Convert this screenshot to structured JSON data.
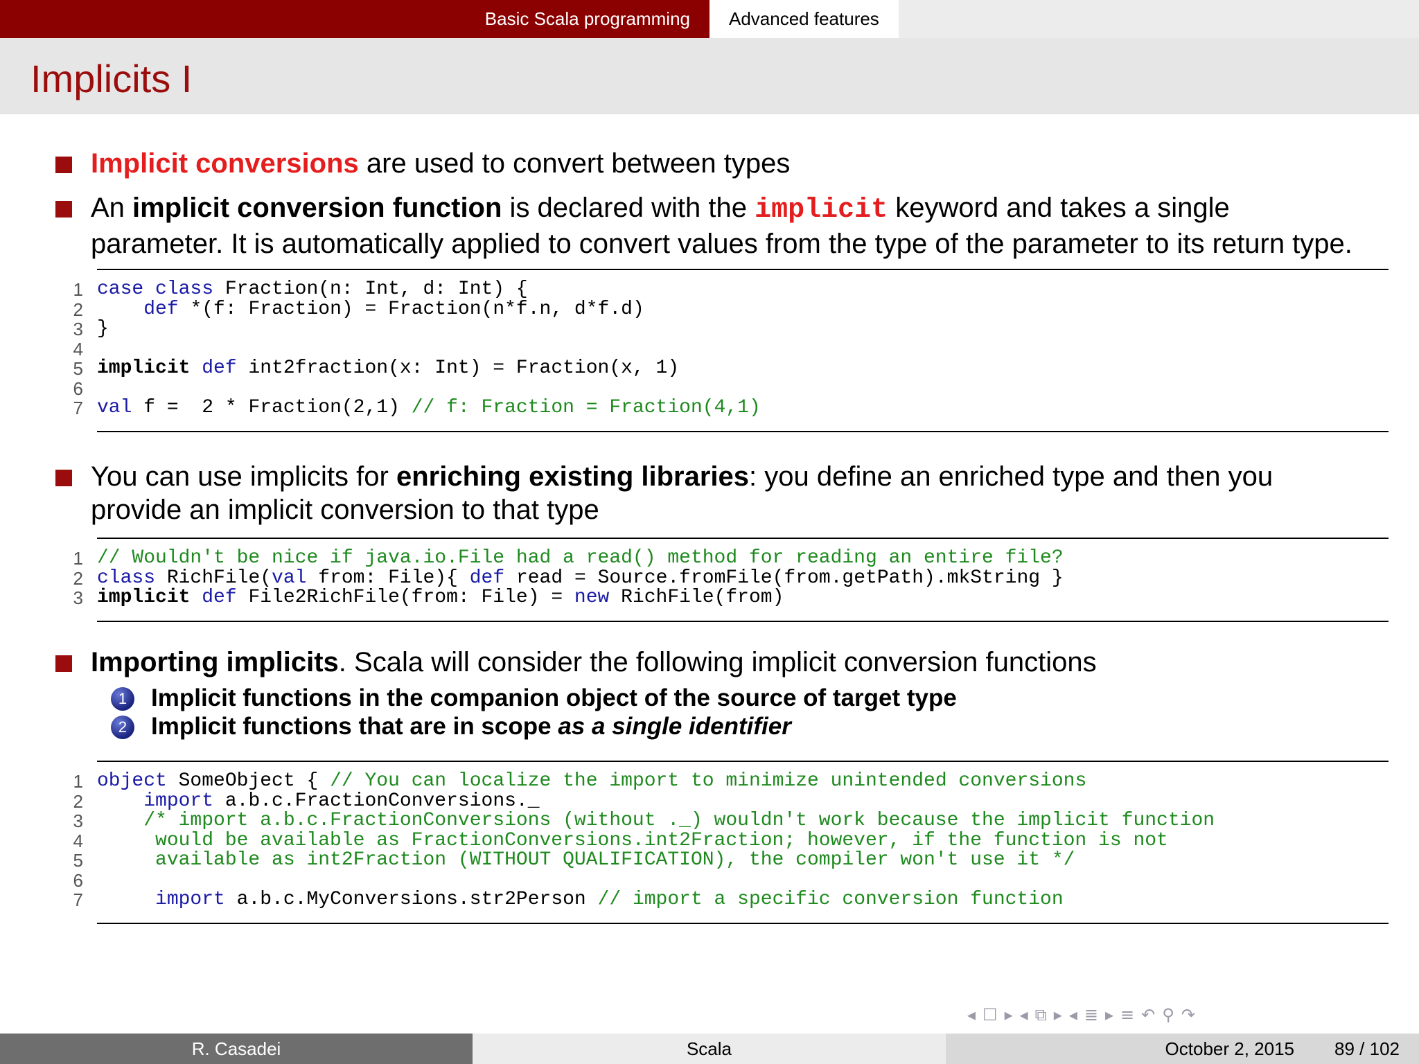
{
  "header": {
    "sections": [
      "Basic Scala programming",
      "Advanced features"
    ],
    "title": "Implicits I"
  },
  "bullets": {
    "b1": {
      "red": "Implicit conversions",
      "rest": " are used to convert between types"
    },
    "b2": {
      "pre": "An ",
      "bold": "implicit conversion function",
      "mid": " is declared with the ",
      "kw": "implicit",
      "post": " keyword and takes a single",
      "line2": "parameter. It is automatically applied to convert values from the type of the parameter to its return type."
    },
    "b3": {
      "pre": "You can use implicits for ",
      "bold": "enriching existing libraries",
      "post": ": you define an enriched type and then you",
      "line2": "provide an implicit conversion to that type"
    },
    "b4": {
      "bold": "Importing implicits",
      "post": ". Scala will consider the following implicit conversion functions"
    }
  },
  "enumeration": [
    {
      "num": "1",
      "text": "Implicit functions in the companion object of the source of target type"
    },
    {
      "num": "2",
      "pre": "Implicit functions that are in scope ",
      "em": "as a single identifier"
    }
  ],
  "code1": {
    "line_numbers": [
      "1",
      "2",
      "3",
      "4",
      "5",
      "6",
      "7"
    ],
    "l1": {
      "k1": "case class",
      "t1": " Fraction(n: Int, d: Int) {"
    },
    "l2": {
      "ind": "    ",
      "k1": "def",
      "t1": " *(f: Fraction) = Fraction(n*f.n, d*f.d)"
    },
    "l3": {
      "t1": "}"
    },
    "l5": {
      "b1": "implicit",
      "k1": " def",
      "t1": " int2fraction(x: Int) = Fraction(x, 1)"
    },
    "l7": {
      "k1": "val",
      "t1": " f =  2 * Fraction(2,1) ",
      "c1": "// f: Fraction = Fraction(4,1)"
    }
  },
  "code2": {
    "line_numbers": [
      "1",
      "2",
      "3"
    ],
    "l1": {
      "c1": "// Wouldn't be nice if java.io.File had a read() method for reading an entire file?"
    },
    "l2": {
      "k1": "class",
      "t1": " RichFile(",
      "k2": "val",
      "t2": " from: File){ ",
      "k3": "def",
      "t3": " read = Source.fromFile(from.getPath).mkString }"
    },
    "l3": {
      "b1": "implicit",
      "k1": " def",
      "t1": " File2RichFile(from: File) = ",
      "k2": "new",
      "t2": " RichFile(from)"
    }
  },
  "code3": {
    "line_numbers": [
      "1",
      "2",
      "3",
      "4",
      "5",
      "6",
      "7"
    ],
    "l1": {
      "k1": "object",
      "t1": " SomeObject { ",
      "c1": "// You can localize the import to minimize unintended conversions"
    },
    "l2": {
      "ind": "    ",
      "k1": "import",
      "t1": " a.b.c.FractionConversions._"
    },
    "l3": {
      "ind": "    ",
      "c1": "/* import a.b.c.FractionConversions (without ._) wouldn't work because the implicit function"
    },
    "l4": {
      "c1": "     would be available as FractionConversions.int2Fraction; however, if the function is not"
    },
    "l5": {
      "c1": "     available as int2Fraction (WITHOUT QUALIFICATION), the compiler won't use it */"
    },
    "l7": {
      "ind": "     ",
      "k1": "import",
      "t1": " a.b.c.MyConversions.str2Person ",
      "c1": "// import a specific conversion function"
    }
  },
  "footer": {
    "author": "R. Casadei",
    "short_title": "Scala",
    "date": "October 2, 2015",
    "page": "89 / 102"
  },
  "colors": {
    "accent": "#8b0000",
    "title": "#9b0d0d",
    "highlight": "#e41e1e",
    "code_keyword": "#1a1aa6",
    "code_comment": "#1e8a1e"
  },
  "nav_icons": [
    "frame-prev-icon",
    "frame-icon",
    "frame-next-icon",
    "subsection-prev-icon",
    "subsection-icon",
    "subsection-next-icon",
    "section-prev-icon",
    "section-icon",
    "section-next-icon",
    "align-icon",
    "back-icon",
    "search-icon",
    "forward-icon"
  ]
}
